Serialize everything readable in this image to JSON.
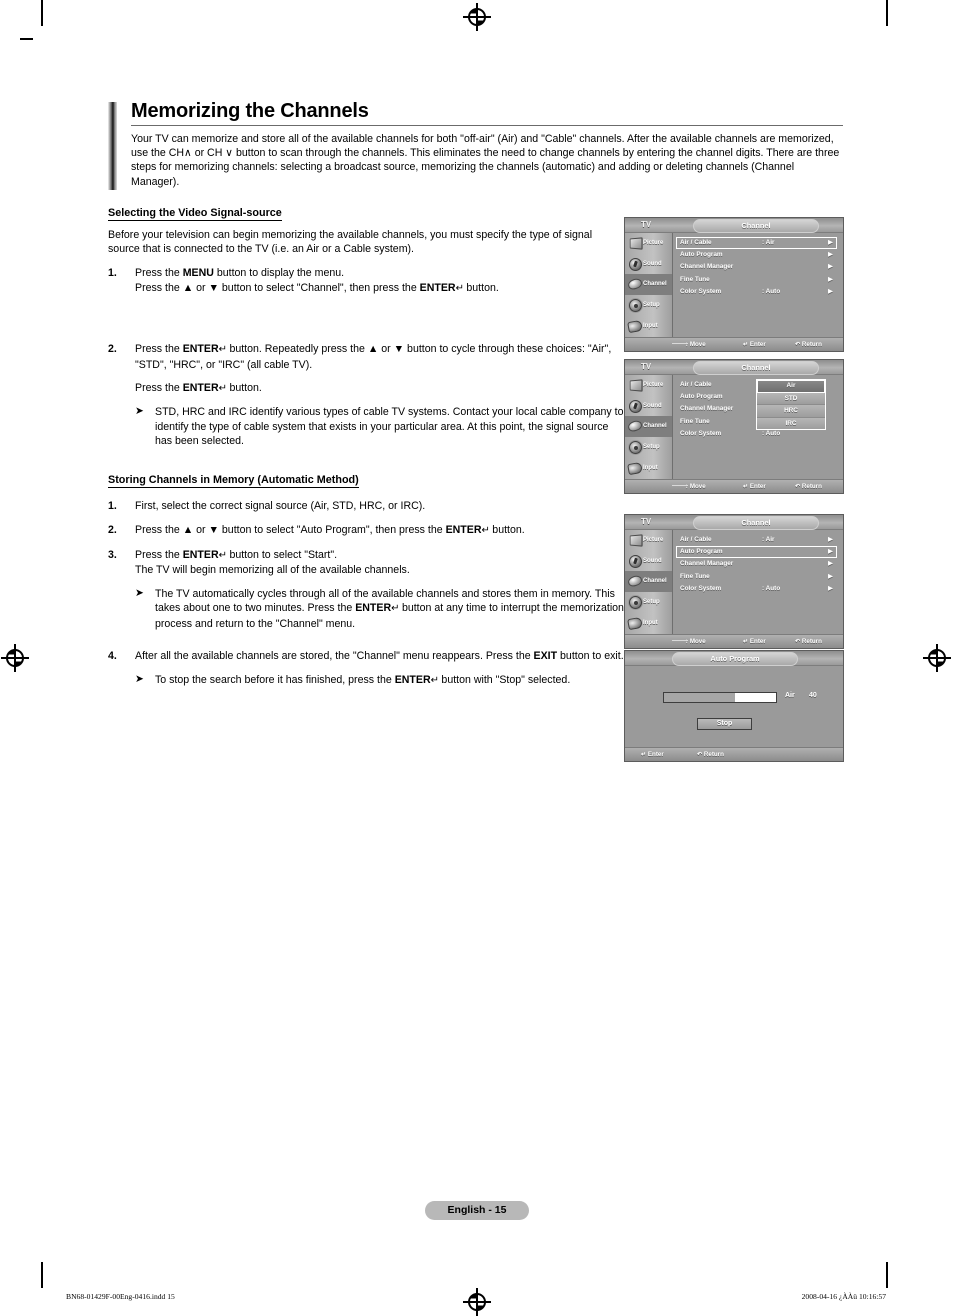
{
  "document": {
    "title": "Memorizing the Channels",
    "intro": "Your TV can memorize and store all of the available channels for both \"off-air\" (Air) and \"Cable\" channels. After the available channels are memorized, use the CH∧ or CH ∨ button to scan through the channels. This eliminates the need to change channels by entering the channel digits. There are three steps for memorizing channels: selecting a broadcast source, memorizing the channels (automatic) and adding or deleting channels (Channel Manager).",
    "page_label": "English - 15",
    "footer_left": "BN68-01429F-00Eng-0416.indd   15",
    "footer_right": "2008-04-16   ¿ÀÀü 10:16:57"
  },
  "section1": {
    "heading": "Selecting the Video Signal-source",
    "paragraph": "Before your television can begin memorizing the available channels, you must specify the type of signal source that is connected to the TV (i.e. an Air or a Cable system).",
    "steps": [
      {
        "num": "1.",
        "line1_a": "Press the ",
        "line1_b": "MENU",
        "line1_c": " button to display the menu.",
        "line2_a": "Press the ▲ or ▼ button to select \"Channel\", then press the ",
        "line2_b": "ENTER",
        "line2_c": " button."
      },
      {
        "num": "2.",
        "line1_a": "Press the ",
        "line1_b": "ENTER",
        "line1_c": " button. Repeatedly press the ▲ or ▼ button to cycle through these choices: \"Air\", \"STD\", \"HRC\", or \"IRC\" (all cable TV).",
        "line2_a": "Press the ",
        "line2_b": "ENTER",
        "line2_c": " button.",
        "note": "STD, HRC and IRC identify various types of cable TV systems. Contact your local cable company to identify the type of cable system that exists in your particular area. At this point, the signal source has been selected."
      }
    ]
  },
  "section2": {
    "heading": "Storing Channels in Memory (Automatic Method)",
    "steps": [
      {
        "num": "1.",
        "text": "First, select the correct signal source (Air, STD, HRC, or IRC)."
      },
      {
        "num": "2.",
        "text_a": "Press the ▲ or ▼ button to select \"Auto Program\", then press the ",
        "text_b": "ENTER",
        "text_c": " button."
      },
      {
        "num": "3.",
        "text_a": "Press the ",
        "text_b": "ENTER",
        "text_c": " button to select \"Start\".",
        "text_d": "The TV will begin memorizing  all of the available channels.",
        "note_a": "The TV automatically cycles through all of the available channels and stores them in memory. This takes about one to two minutes. Press the ",
        "note_b": "ENTER",
        "note_c": " button at any time to interrupt the memorization process and return to the \"Channel\" menu."
      },
      {
        "num": "4.",
        "text_a": "After all the available channels are stored, the \"Channel\" menu reappears. Press the ",
        "text_b": "EXIT",
        "text_c": " button to exit.",
        "note_a": "To stop the search before it has finished, press the ",
        "note_b": "ENTER",
        "note_c": " button with \"Stop\" selected."
      }
    ]
  },
  "osd": {
    "device_label": "TV",
    "tab_title": "Channel",
    "sidebar": [
      {
        "label": "Picture",
        "icon": "picture-icon"
      },
      {
        "label": "Sound",
        "icon": "speaker-icon"
      },
      {
        "label": "Channel",
        "icon": "satellite-dish-icon"
      },
      {
        "label": "Setup",
        "icon": "gear-icon"
      },
      {
        "label": "Input",
        "icon": "plug-icon"
      }
    ],
    "menu_rows": [
      {
        "label": "Air / Cable",
        "value": ": Air",
        "arrow": "▶"
      },
      {
        "label": "Auto Program",
        "value": "",
        "arrow": "▶"
      },
      {
        "label": "Channel Manager",
        "value": "",
        "arrow": "▶"
      },
      {
        "label": "Fine Tune",
        "value": "",
        "arrow": "▶"
      },
      {
        "label": "Color System",
        "value": ": Auto",
        "arrow": "▶"
      }
    ],
    "air_cable_label_only": "Air / Cable",
    "air_cable_colon": ":",
    "dropdown_options": [
      "Air",
      "STD",
      "HRC",
      "IRC"
    ],
    "dropdown_selected": "Air",
    "hints": {
      "move": "Move",
      "enter": "Enter",
      "return": "Return",
      "move_icon": "↕",
      "enter_icon": "↵",
      "return_icon": "↶"
    },
    "selected_row_screen1": "Air / Cable",
    "selected_row_screen3": "Auto Program"
  },
  "auto_program_dialog": {
    "tab_title": "Auto Program",
    "progress_percent": 63,
    "source_label": "Air",
    "channel_number": "40",
    "stop_button": "Stop",
    "hints": {
      "enter": "Enter",
      "return": "Return",
      "enter_icon": "↵",
      "return_icon": "↶"
    }
  }
}
